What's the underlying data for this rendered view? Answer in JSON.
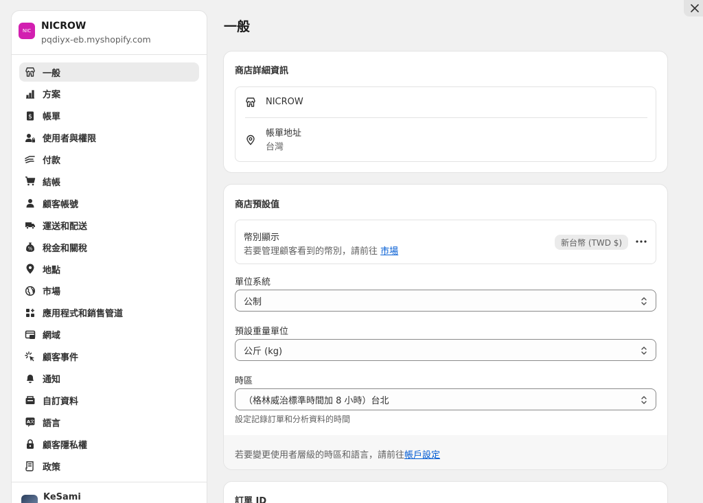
{
  "store": {
    "avatar_text": "NIC",
    "avatar_color": "#d21fb0",
    "name": "NICROW",
    "domain": "pqdiyx-eb.myshopify.com"
  },
  "sidebar": {
    "items": [
      {
        "label": "一般",
        "icon": "store-icon",
        "active": true
      },
      {
        "label": "方案",
        "icon": "chart-icon"
      },
      {
        "label": "帳單",
        "icon": "bill-icon"
      },
      {
        "label": "使用者與權限",
        "icon": "users-lock-icon"
      },
      {
        "label": "付款",
        "icon": "payment-icon"
      },
      {
        "label": "結帳",
        "icon": "cart-icon"
      },
      {
        "label": "顧客帳號",
        "icon": "person-icon"
      },
      {
        "label": "運送和配送",
        "icon": "truck-icon"
      },
      {
        "label": "稅金和關稅",
        "icon": "tax-icon"
      },
      {
        "label": "地點",
        "icon": "location-icon"
      },
      {
        "label": "市場",
        "icon": "globe-icon"
      },
      {
        "label": "應用程式和銷售管道",
        "icon": "apps-icon"
      },
      {
        "label": "網域",
        "icon": "domain-icon"
      },
      {
        "label": "顧客事件",
        "icon": "cursor-click-icon"
      },
      {
        "label": "通知",
        "icon": "bell-icon"
      },
      {
        "label": "自訂資料",
        "icon": "database-icon"
      },
      {
        "label": "語言",
        "icon": "language-icon"
      },
      {
        "label": "顧客隱私權",
        "icon": "lock-icon"
      },
      {
        "label": "政策",
        "icon": "policy-icon"
      }
    ],
    "user_name": "KeSami"
  },
  "page": {
    "title": "一般"
  },
  "store_details": {
    "title": "商店詳細資訊",
    "store_name": "NICROW",
    "billing_label": "帳單地址",
    "billing_value": "台灣"
  },
  "store_defaults": {
    "title": "商店預設值",
    "currency_title": "幣別顯示",
    "currency_desc": "若要管理顧客看到的幣別，請前往 ",
    "currency_link": "市場",
    "currency_badge": "新台幣 (TWD $)",
    "more_icon": "more-horizontal-icon",
    "unit_system_label": "單位系統",
    "unit_system_value": "公制",
    "weight_label": "預設重量單位",
    "weight_value": "公斤 (kg)",
    "timezone_label": "時區",
    "timezone_value": "（格林威治標準時間加 8 小時）台北",
    "timezone_help": "設定記錄訂單和分析資料的時間",
    "footer_text": "若要變更使用者層級的時區和語言，請前往",
    "footer_link": "帳戶設定"
  },
  "order_id": {
    "title": "訂單 ID"
  },
  "colors": {
    "accent_link": "#005bd3",
    "background": "#f1f1f1"
  }
}
